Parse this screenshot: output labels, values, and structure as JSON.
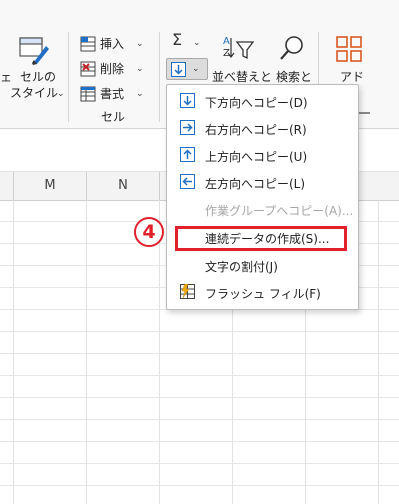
{
  "ribbon": {
    "cell_style_label_1": "セルの",
    "cell_style_label_2": "スタイル",
    "insert_label": "挿入",
    "delete_label": "削除",
    "format_label": "書式",
    "cells_group_label": "セル",
    "sort_filter_label": "並べ替えと",
    "find_select_label": "検索と",
    "addin_label": "アド",
    "left_edge_label": "ェ",
    "sigma_symbol": "Σ",
    "chevron": "⌄"
  },
  "grid": {
    "columns": [
      "M",
      "N"
    ]
  },
  "fill_menu": {
    "items": [
      {
        "label": "下方向へコピー(D)",
        "icon": "fill-down-icon",
        "enabled": true
      },
      {
        "label": "右方向へコピー(R)",
        "icon": "fill-right-icon",
        "enabled": true
      },
      {
        "label": "上方向へコピー(U)",
        "icon": "fill-up-icon",
        "enabled": true
      },
      {
        "label": "左方向へコピー(L)",
        "icon": "fill-left-icon",
        "enabled": true
      },
      {
        "label": "作業グループへコピー(A)...",
        "icon": "",
        "enabled": false
      },
      {
        "label": "連続データの作成(S)...",
        "icon": "",
        "enabled": true
      },
      {
        "label": "文字の割付(J)",
        "icon": "",
        "enabled": true
      },
      {
        "label": "フラッシュ フィル(F)",
        "icon": "flash-fill-icon",
        "enabled": true
      }
    ]
  },
  "annotation": {
    "step_badge": "4"
  },
  "colors": {
    "accent_blue": "#1f6fc5",
    "highlight_red": "#e0202a",
    "orange_addin": "#d9581f"
  }
}
